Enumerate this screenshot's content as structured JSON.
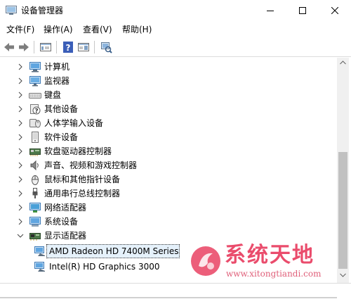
{
  "window": {
    "title": "设备管理器",
    "buttons": {
      "minimize": "minimize-icon",
      "maximize": "maximize-icon",
      "close": "close-icon"
    }
  },
  "menu": {
    "file": "文件(F)",
    "action": "操作(A)",
    "view": "查看(V)",
    "help": "帮助(H)"
  },
  "toolbar": {
    "icons": [
      "back-arrow-icon",
      "forward-arrow-icon",
      "properties-icon",
      "help-icon",
      "view-pane-icon",
      "scan-hardware-icon"
    ]
  },
  "tree": {
    "categories": [
      {
        "label": "计算机",
        "icon": "computer-icon",
        "expanded": false
      },
      {
        "label": "监视器",
        "icon": "monitor-icon",
        "expanded": false
      },
      {
        "label": "键盘",
        "icon": "keyboard-icon",
        "expanded": false
      },
      {
        "label": "其他设备",
        "icon": "other-devices-icon",
        "expanded": false
      },
      {
        "label": "人体学输入设备",
        "icon": "hid-icon",
        "expanded": false
      },
      {
        "label": "软件设备",
        "icon": "software-device-icon",
        "expanded": false
      },
      {
        "label": "软盘驱动器控制器",
        "icon": "floppy-controller-icon",
        "expanded": false
      },
      {
        "label": "声音、视频和游戏控制器",
        "icon": "speaker-icon",
        "expanded": false
      },
      {
        "label": "鼠标和其他指针设备",
        "icon": "mouse-icon",
        "expanded": false
      },
      {
        "label": "通用串行总线控制器",
        "icon": "usb-icon",
        "expanded": false
      },
      {
        "label": "网络适配器",
        "icon": "network-adapter-icon",
        "expanded": false
      },
      {
        "label": "系统设备",
        "icon": "system-device-icon",
        "expanded": false
      },
      {
        "label": "显示适配器",
        "icon": "display-adapter-icon",
        "expanded": true
      }
    ],
    "display_adapters": [
      {
        "label": "AMD Radeon HD 7400M Series",
        "selected": true
      },
      {
        "label": "Intel(R) HD Graphics 3000",
        "selected": false
      }
    ]
  },
  "watermark": {
    "title": "系统天地",
    "url": "www.xitongtiandi.com"
  },
  "colors": {
    "selection_bg": "#e5f1fb",
    "watermark": "#ea4c6c",
    "scroll_thumb": "#c1c1c1"
  }
}
